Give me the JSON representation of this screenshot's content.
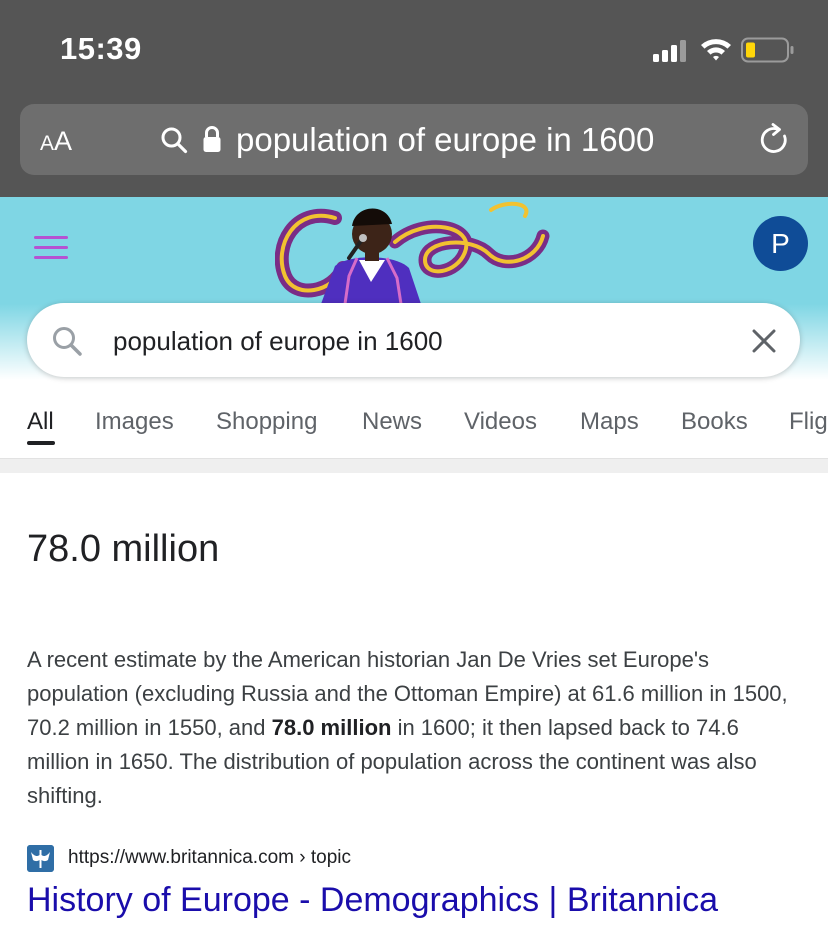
{
  "status_bar": {
    "time": "15:39"
  },
  "address_bar": {
    "text_size_label_small": "A",
    "text_size_label_large": "A",
    "url_text": "population of europe in 1600"
  },
  "google": {
    "account_initial": "P",
    "search_query": "population of europe in 1600",
    "colors": {
      "header_bg": "#7fd6e4",
      "menu_icon": "#b552d2",
      "avatar_bg": "#0f4c97",
      "link": "#1a0dab"
    }
  },
  "tabs": [
    {
      "label": "All",
      "active": true
    },
    {
      "label": "Images",
      "active": false
    },
    {
      "label": "Shopping",
      "active": false
    },
    {
      "label": "News",
      "active": false
    },
    {
      "label": "Videos",
      "active": false
    },
    {
      "label": "Maps",
      "active": false
    },
    {
      "label": "Books",
      "active": false
    },
    {
      "label": "Flig",
      "active": false
    }
  ],
  "featured_snippet": {
    "answer": "78.0 million",
    "text_before": "A recent estimate by the American historian Jan De Vries set Europe's population (excluding Russia and the Ottoman Empire) at 61.6 million in 1500, 70.2 million in 1550, and ",
    "text_bold": "78.0 million",
    "text_after": " in 1600; it then lapsed back to 74.6 million in 1650. The distribution of population across the continent was also shifting.",
    "source_url": "https://www.britannica.com › topic",
    "result_title": "History of Europe - Demographics | Britannica"
  },
  "icons": [
    "signal-icon",
    "wifi-icon",
    "battery-icon",
    "search-icon",
    "lock-icon",
    "reload-icon",
    "menu-icon",
    "close-icon",
    "britannica-favicon"
  ]
}
